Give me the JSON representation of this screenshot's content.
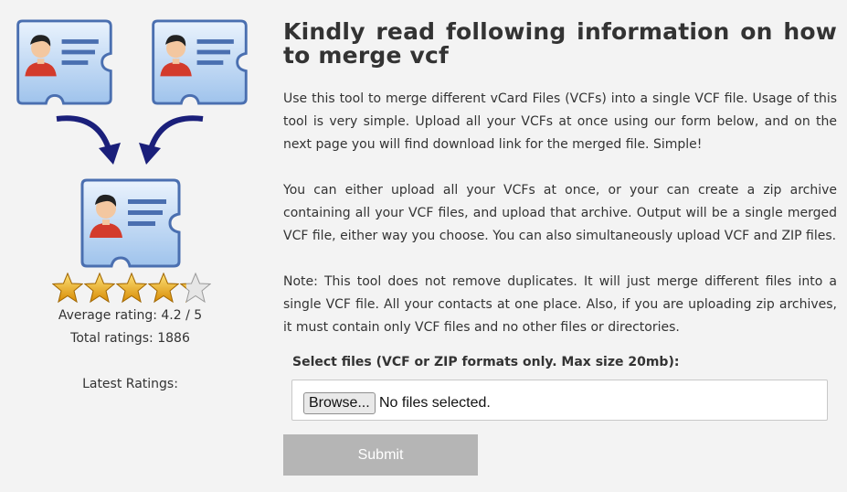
{
  "heading": "Kindly read following information on how to merge vcf",
  "paragraphs": [
    "Use this tool to merge different vCard Files (VCFs) into a single VCF file. Usage of this tool is very simple. Upload all your VCFs at once using our form below, and on the next page you will find download link for the merged file. Simple!",
    "You can either upload all your VCFs at once, or your can create a zip archive containing all your VCF files, and upload that archive. Output will be a single merged VCF file, either way you choose. You can also simultaneously upload VCF and ZIP files.",
    "Note: This tool does not remove duplicates. It will just merge different files into a single VCF file. All your contacts at one place. Also, if you are uploading zip archives, it must contain only VCF files and no other files or directories."
  ],
  "rating": {
    "value": 4.2,
    "max": 5,
    "average_text": "Average rating: 4.2 / 5",
    "total_text": "Total ratings: 1886",
    "latest_label": "Latest Ratings:"
  },
  "form": {
    "select_label": "Select files (VCF or ZIP formats only. Max size 20mb):",
    "browse_label": "Browse...",
    "no_file_text": "No files selected.",
    "submit_label": "Submit"
  },
  "icons": {
    "contact_card": "contact-card-icon",
    "merge_arrow": "curved-arrow-icon",
    "star": "star-icon"
  },
  "colors": {
    "background": "#f3f3f3",
    "submit_bg": "#b5b5b5",
    "star_gold": "#f2b515",
    "arrow_navy": "#1a1f7a"
  }
}
